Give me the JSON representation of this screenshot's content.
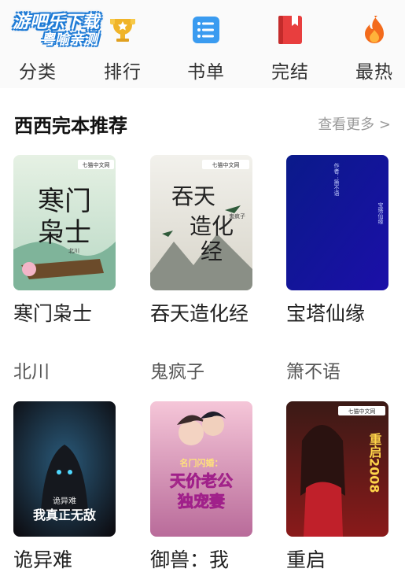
{
  "watermark": {
    "line1": "游吧乐下载",
    "line2": "粤喻亲测"
  },
  "nav": [
    {
      "label": "分类",
      "icon": "category-icon"
    },
    {
      "label": "排行",
      "icon": "trophy-icon"
    },
    {
      "label": "书单",
      "icon": "list-icon"
    },
    {
      "label": "完结",
      "icon": "book-icon"
    },
    {
      "label": "最热",
      "icon": "flame-icon"
    }
  ],
  "section": {
    "title": "西西完本推荐",
    "more": "查看更多 >"
  },
  "books": [
    {
      "title": "寒门枭士",
      "author": "北川",
      "cover_text": "寒门枭士",
      "cover_author": "北川",
      "publisher": "七猫中文网"
    },
    {
      "title": "吞天造化经",
      "author": "鬼疯子",
      "cover_text": "吞天造化经",
      "cover_author": "鬼疯子",
      "publisher": "七猫中文网"
    },
    {
      "title": "宝塔仙缘",
      "author": "箫不语",
      "cover_text": "宝塔仙缘",
      "cover_author": "作者：箫不语"
    },
    {
      "title": "诡异难",
      "author": "",
      "cover_text": "诡异难 我真正无敌"
    },
    {
      "title": "御兽：我",
      "author": "",
      "cover_text": "天价老公独宠妻",
      "cover_subtext": "名门闪婚："
    },
    {
      "title": "重启",
      "author": "",
      "cover_text": "重启2008",
      "publisher": "七猫中文网"
    }
  ],
  "colors": {
    "accent": "#e83e3e",
    "list_blue": "#3a9bf0",
    "trophy": "#f0b429",
    "flame": "#f36b1c"
  }
}
